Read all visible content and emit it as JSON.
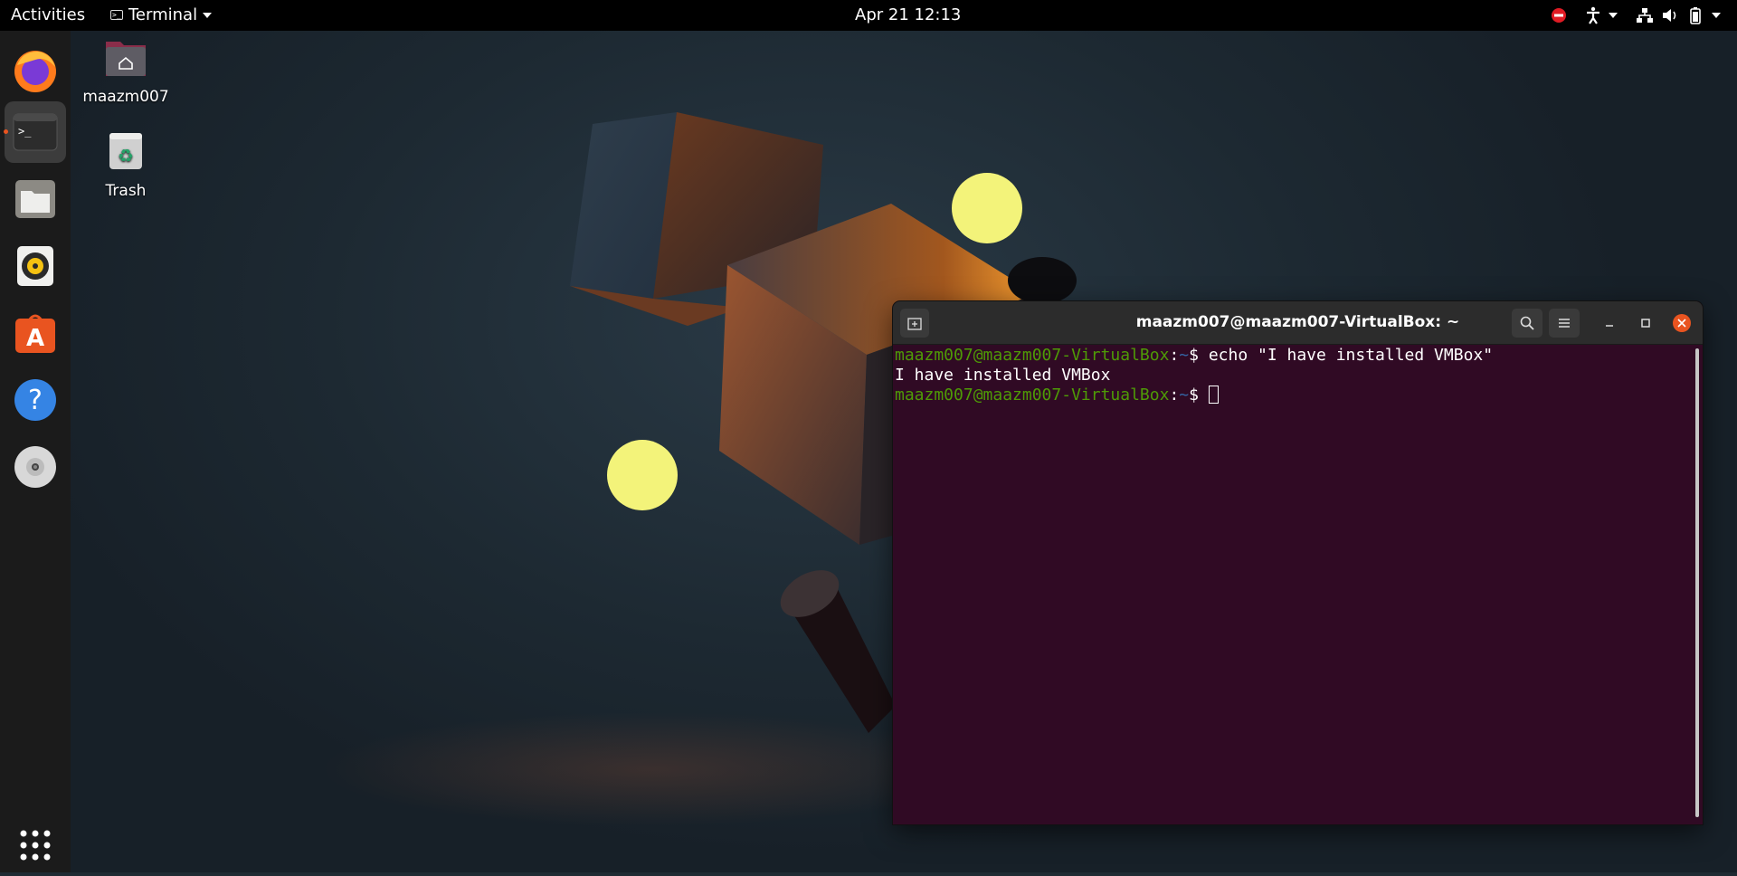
{
  "topbar": {
    "activities": "Activities",
    "app_name": "Terminal",
    "clock": "Apr 21  12:13"
  },
  "dock": {
    "items": [
      "firefox-icon",
      "terminal-icon",
      "files-icon",
      "rhythmbox-icon",
      "ubuntu-software-icon",
      "help-icon",
      "dvd-icon",
      "show-applications-icon"
    ]
  },
  "desktop": {
    "home_label": "maazm007",
    "trash_label": "Trash"
  },
  "terminal": {
    "title": "maazm007@maazm007-VirtualBox: ~",
    "lines": [
      {
        "user": "maazm007@maazm007-VirtualBox",
        "sep": ":",
        "path": "~",
        "prompt": "$ ",
        "cmd": "echo \"I have installed VMBox\""
      },
      {
        "output": "I have installed VMBox"
      },
      {
        "user": "maazm007@maazm007-VirtualBox",
        "sep": ":",
        "path": "~",
        "prompt": "$ ",
        "cmd": ""
      }
    ]
  },
  "colors": {
    "terminal_bg": "#300a24",
    "prompt_user": "#4e9a06",
    "prompt_path": "#3465a4",
    "accent": "#e95420"
  }
}
